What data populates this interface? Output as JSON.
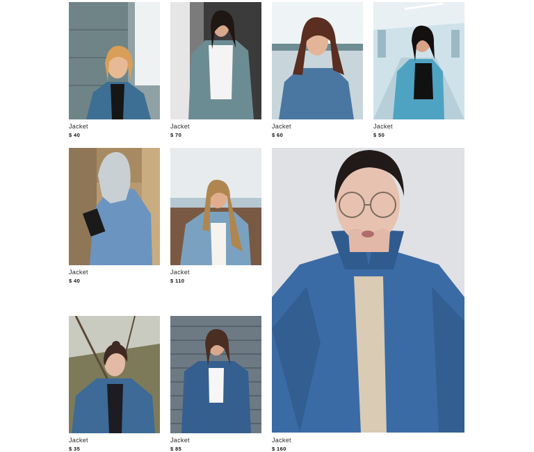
{
  "products": [
    {
      "name": "Jacket",
      "price": "$ 40"
    },
    {
      "name": "Jacket",
      "price": "$ 70"
    },
    {
      "name": "Jacket",
      "price": "$ 60"
    },
    {
      "name": "Jacket",
      "price": "$ 50"
    },
    {
      "name": "Jacket",
      "price": "$ 40"
    },
    {
      "name": "Jacket",
      "price": "$ 110"
    },
    {
      "name": "Jacket",
      "price": "$ 160"
    },
    {
      "name": "Jacket",
      "price": "$ 35"
    },
    {
      "name": "Jacket",
      "price": "$ 85"
    }
  ]
}
